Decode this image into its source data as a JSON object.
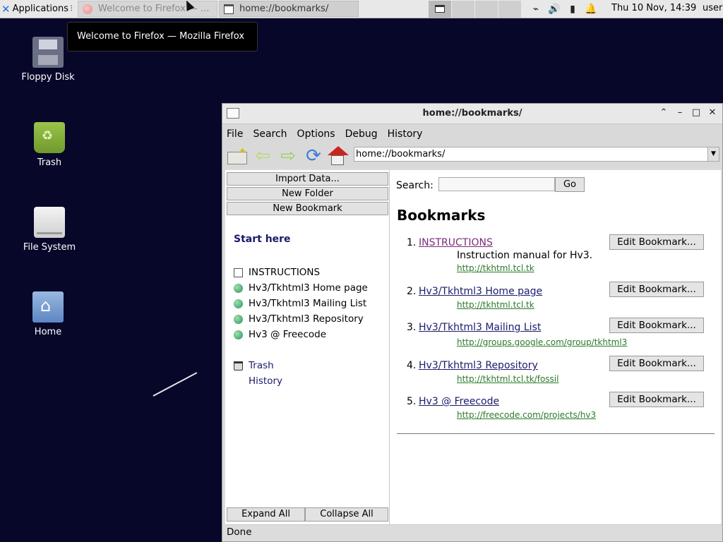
{
  "panel": {
    "applications": "Applications",
    "tasks": [
      {
        "label": "Welcome to Firefox — ..."
      },
      {
        "label": "home://bookmarks/"
      }
    ],
    "clock": "Thu 10 Nov, 14:39",
    "user": "user"
  },
  "tooltip": "Welcome to Firefox — Mozilla Firefox",
  "desktop": {
    "icons": [
      {
        "label": "Floppy Disk"
      },
      {
        "label": "Trash"
      },
      {
        "label": "File System"
      },
      {
        "label": "Home"
      }
    ]
  },
  "window": {
    "title": "home://bookmarks/",
    "menu": [
      "File",
      "Search",
      "Options",
      "Debug",
      "History"
    ],
    "url": "home://bookmarks/",
    "sidebar": {
      "buttons": [
        "Import Data...",
        "New Folder",
        "New Bookmark"
      ],
      "start_here": "Start here",
      "items": [
        "INSTRUCTIONS",
        "Hv3/Tkhtml3 Home page",
        "Hv3/Tkhtml3 Mailing List",
        "Hv3/Tkhtml3 Repository",
        "Hv3 @ Freecode"
      ],
      "trash": "Trash",
      "history": "History",
      "expand_all": "Expand All",
      "collapse_all": "Collapse All"
    },
    "main": {
      "search_label": "Search:",
      "go_label": "Go",
      "heading": "Bookmarks",
      "bookmarks": [
        {
          "num": "1.",
          "name": "INSTRUCTIONS",
          "desc": "Instruction manual for Hv3.",
          "url": "http://tkhtml.tcl.tk",
          "edit": "Edit Bookmark..."
        },
        {
          "num": "2.",
          "name": "Hv3/Tkhtml3 Home page",
          "desc": "",
          "url": "http://tkhtml.tcl.tk",
          "edit": "Edit Bookmark..."
        },
        {
          "num": "3.",
          "name": "Hv3/Tkhtml3 Mailing List",
          "desc": "",
          "url": "http://groups.google.com/group/tkhtml3",
          "edit": "Edit Bookmark..."
        },
        {
          "num": "4.",
          "name": "Hv3/Tkhtml3 Repository",
          "desc": "",
          "url": "http://tkhtml.tcl.tk/fossil",
          "edit": "Edit Bookmark..."
        },
        {
          "num": "5.",
          "name": "Hv3 @ Freecode",
          "desc": "",
          "url": "http://freecode.com/projects/hv3",
          "edit": "Edit Bookmark..."
        }
      ]
    },
    "status": "Done"
  }
}
